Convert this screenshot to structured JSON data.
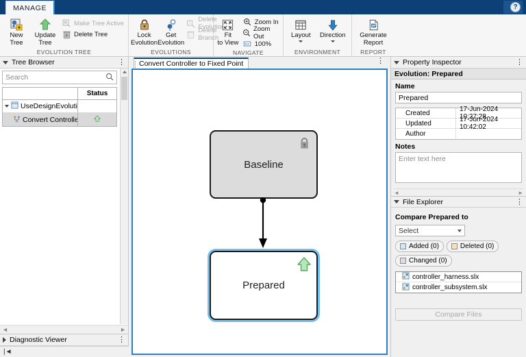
{
  "titlebar": {
    "tab_label": "MANAGE",
    "help_icon": "help-circle-icon"
  },
  "ribbon": {
    "groups": [
      {
        "title": "EVOLUTION TREE",
        "large": [
          {
            "label": "New\nTree",
            "icon": "new-tree-icon"
          },
          {
            "label": "Update\nTree",
            "icon": "update-tree-icon"
          }
        ],
        "small": [
          {
            "label": "Make Tree Active",
            "icon": "make-tree-active-icon",
            "disabled": true
          },
          {
            "label": "Delete Tree",
            "icon": "trash-icon",
            "disabled": false
          }
        ]
      },
      {
        "title": "EVOLUTIONS",
        "large": [
          {
            "label": "Lock\nEvolution",
            "icon": "lock-icon"
          },
          {
            "label": "Get\nEvolution",
            "icon": "get-evolution-icon"
          }
        ],
        "small": [
          {
            "label": "Delete Evolution",
            "icon": "delete-evolution-icon",
            "disabled": true
          },
          {
            "label": "Delete Branch",
            "icon": "trash-icon",
            "disabled": true
          }
        ]
      },
      {
        "title": "NAVIGATE",
        "large": [
          {
            "label": "Fit\nto View",
            "icon": "fit-to-view-icon"
          }
        ],
        "small": [
          {
            "label": "Zoom In",
            "icon": "zoom-in-icon",
            "disabled": false
          },
          {
            "label": "Zoom Out",
            "icon": "zoom-out-icon",
            "disabled": false
          },
          {
            "label": "100%",
            "icon": "zoom-level-icon",
            "disabled": false
          }
        ]
      },
      {
        "title": "ENVIRONMENT",
        "large": [
          {
            "label": "Layout",
            "icon": "layout-icon",
            "caret": true
          },
          {
            "label": "Direction",
            "icon": "direction-icon",
            "caret": true
          }
        ],
        "small": []
      },
      {
        "title": "REPORT",
        "large": [
          {
            "label": "Generate\nReport",
            "icon": "generate-report-icon"
          }
        ],
        "small": []
      }
    ]
  },
  "tree_browser": {
    "title": "Tree Browser",
    "kebab": "⋮",
    "search_placeholder": "Search",
    "search_value": "",
    "search_icon": "search-icon",
    "columns": [
      "",
      "Status"
    ],
    "rows": [
      {
        "label": "UseDesignEvolutionMar",
        "icon": "model-file-icon",
        "expander": true,
        "status": "",
        "selected": false
      },
      {
        "label": "Convert Controller tc",
        "icon": "evolution-tree-icon",
        "expander": false,
        "status": "up-arrow-green",
        "selected": true
      }
    ]
  },
  "diagnostic_viewer": {
    "title": "Diagnostic Viewer",
    "kebab": "⋮"
  },
  "canvas": {
    "tab_label": "Convert Controller to Fixed Point",
    "kebab": "⋮",
    "nodes": [
      {
        "id": "baseline",
        "label": "Baseline",
        "badge": "lock-icon",
        "selected": false
      },
      {
        "id": "prepared",
        "label": "Prepared",
        "badge": "up-arrow-green-icon",
        "selected": true
      }
    ]
  },
  "property_inspector": {
    "title": "Property Inspector",
    "kebab": "⋮",
    "subtitle": "Evolution: Prepared",
    "name_label": "Name",
    "name_value": "Prepared",
    "properties": [
      {
        "key": "Created",
        "value": "17-Jun-2024 10:27:28"
      },
      {
        "key": "Updated",
        "value": "17-Jun-2024 10:42:02"
      },
      {
        "key": "Author",
        "value": ""
      }
    ],
    "notes_label": "Notes",
    "notes_placeholder": "Enter text here",
    "notes_value": ""
  },
  "file_explorer": {
    "title": "File Explorer",
    "kebab": "⋮",
    "compare_label": "Compare  Prepared  to",
    "select_value": "Select",
    "chips": [
      {
        "label": "Added (0)",
        "color": "#cfe6f7"
      },
      {
        "label": "Deleted (0)",
        "color": "#f5e2c4"
      },
      {
        "label": "Changed (0)",
        "color": "#e2d6f0"
      }
    ],
    "files": [
      {
        "name": "controller_harness.slx",
        "icon": "slx-file-icon"
      },
      {
        "name": "controller_subsystem.slx",
        "icon": "slx-file-icon"
      }
    ],
    "compare_button": "Compare Files"
  },
  "colors": {
    "titlebar": "#0c4077",
    "accent": "#2a7ec4",
    "selection_glow": "#74c0f0",
    "node_baseline_fill": "#dcdcdc",
    "node_prepared_fill": "#ffffff",
    "status_green": "#7fd18a"
  }
}
